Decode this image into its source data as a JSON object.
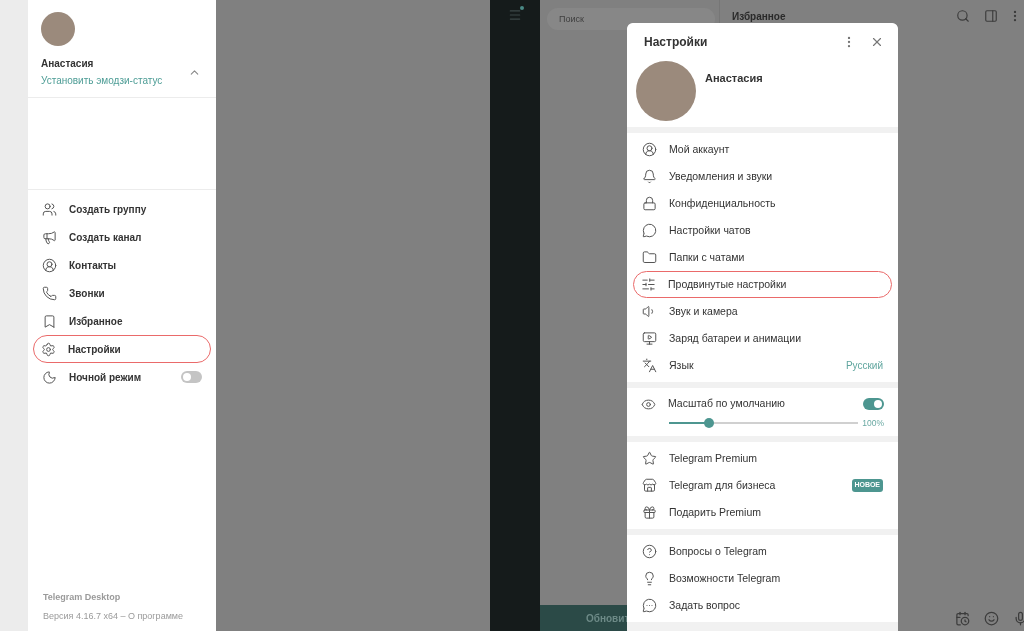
{
  "drawer": {
    "name": "Анастасия",
    "status": "Установить эмодзи-статус",
    "expanded": true,
    "items": [
      {
        "kind": "link",
        "label": "Создать группу",
        "highlighted": false
      },
      {
        "kind": "link",
        "label": "Создать канал",
        "highlighted": false
      },
      {
        "kind": "link",
        "label": "Контакты",
        "highlighted": false
      },
      {
        "kind": "link",
        "label": "Звонки",
        "highlighted": false
      },
      {
        "kind": "link",
        "label": "Избранное",
        "highlighted": false
      },
      {
        "kind": "link",
        "label": "Настройки",
        "highlighted": true
      },
      {
        "kind": "toggle",
        "label": "Ночной режим",
        "highlighted": false,
        "on": false
      }
    ],
    "footer_title": "Telegram Desktop",
    "footer_version": "Версия 4.16.7 x64 – О программе"
  },
  "app": {
    "menu_badge": true,
    "search": {
      "placeholder": "Поиск"
    },
    "update_button": "Обновит",
    "chat_title": "Избранное"
  },
  "settings": {
    "title": "Настройки",
    "name": "Анастасия",
    "sections": [
      {
        "items": [
          {
            "kind": "link",
            "label": "Мой аккаунт",
            "highlighted": false
          },
          {
            "kind": "link",
            "label": "Уведомления и звуки",
            "highlighted": false
          },
          {
            "kind": "link",
            "label": "Конфиденциальность",
            "highlighted": false
          },
          {
            "kind": "link",
            "label": "Настройки чатов",
            "highlighted": false
          },
          {
            "kind": "link",
            "label": "Папки с чатами",
            "highlighted": false
          },
          {
            "kind": "link",
            "label": "Продвинутые настройки",
            "highlighted": true
          },
          {
            "kind": "link",
            "label": "Звук и камера",
            "highlighted": false
          },
          {
            "kind": "link",
            "label": "Заряд батареи и анимации",
            "highlighted": false
          },
          {
            "kind": "link",
            "label": "Язык",
            "highlighted": false,
            "value": "Русский"
          }
        ]
      },
      {
        "items": [
          {
            "kind": "scale",
            "label": "Масштаб по умолчанию",
            "on": true,
            "level": 0.21,
            "reading": "100%"
          }
        ]
      },
      {
        "items": [
          {
            "kind": "link",
            "label": "Telegram Premium",
            "highlighted": false
          },
          {
            "kind": "link",
            "label": "Telegram для бизнеса",
            "highlighted": false,
            "badge": "НОВОЕ"
          },
          {
            "kind": "link",
            "label": "Подарить Premium",
            "highlighted": false
          }
        ]
      },
      {
        "items": [
          {
            "kind": "link",
            "label": "Вопросы о Telegram",
            "highlighted": false
          },
          {
            "kind": "link",
            "label": "Возможности Telegram",
            "highlighted": false
          },
          {
            "kind": "link",
            "label": "Задать вопрос",
            "highlighted": false
          }
        ]
      }
    ]
  }
}
